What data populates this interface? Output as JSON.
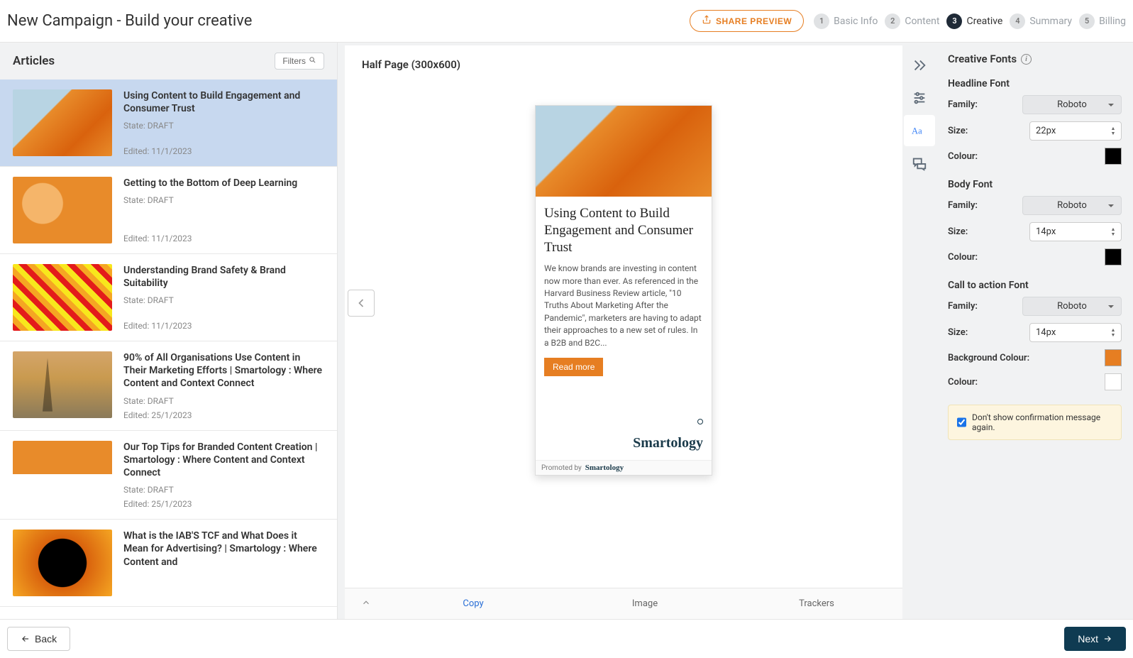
{
  "header": {
    "title": "New Campaign - Build your creative",
    "share_preview": "SHARE PREVIEW",
    "steps": [
      {
        "num": "1",
        "label": "Basic Info",
        "active": false
      },
      {
        "num": "2",
        "label": "Content",
        "active": false
      },
      {
        "num": "3",
        "label": "Creative",
        "active": true
      },
      {
        "num": "4",
        "label": "Summary",
        "active": false
      },
      {
        "num": "5",
        "label": "Billing",
        "active": false
      }
    ]
  },
  "articles_panel": {
    "title": "Articles",
    "filters_label": "Filters"
  },
  "articles": [
    {
      "title": "Using Content to Build Engagement and Consumer Trust",
      "state": "State: DRAFT",
      "edited": "Edited: 11/1/2023",
      "selected": true,
      "thumb": "thumb1"
    },
    {
      "title": "Getting to the Bottom of Deep Learning",
      "state": "State: DRAFT",
      "edited": "Edited: 11/1/2023",
      "selected": false,
      "thumb": "thumb2"
    },
    {
      "title": "Understanding Brand Safety & Brand Suitability",
      "state": "State: DRAFT",
      "edited": "Edited: 11/1/2023",
      "selected": false,
      "thumb": "thumb3"
    },
    {
      "title": "90% of All Organisations Use Content in Their Marketing Efforts | Smartology : Where Content and Context Connect",
      "state": "State: DRAFT",
      "edited": "Edited: 25/1/2023",
      "selected": false,
      "thumb": "thumb4"
    },
    {
      "title": "Our Top Tips for Branded Content Creation | Smartology : Where Content and Context Connect",
      "state": "State: DRAFT",
      "edited": "Edited: 25/1/2023",
      "selected": false,
      "thumb": "thumb5"
    },
    {
      "title": "What is the IAB'S TCF and What Does it Mean for Advertising? | Smartology : Where Content and",
      "state": "",
      "edited": "",
      "selected": false,
      "thumb": "thumb6"
    }
  ],
  "preview": {
    "size_label": "Half Page (300x600)",
    "headline": "Using Content to Build Engagement and Consumer Trust",
    "body": "We know brands are investing in content now more than ever. As referenced in the Harvard Business Review article, \"10 Truths About Marketing After the Pandemic\", marketers are having to adapt their approaches to a new set of rules. In a B2B and B2C...",
    "cta": "Read more",
    "logo": "Smartology",
    "promoted_prefix": "Promoted by",
    "promoted_brand": "Smartology"
  },
  "tabs": {
    "copy": "Copy",
    "image": "Image",
    "trackers": "Trackers"
  },
  "fonts_panel": {
    "title": "Creative Fonts",
    "sections": {
      "headline": {
        "label": "Headline Font",
        "family_label": "Family:",
        "family": "Roboto",
        "size_label": "Size:",
        "size": "22px",
        "colour_label": "Colour:",
        "colour": "#000000"
      },
      "body": {
        "label": "Body Font",
        "family_label": "Family:",
        "family": "Roboto",
        "size_label": "Size:",
        "size": "14px",
        "colour_label": "Colour:",
        "colour": "#000000"
      },
      "cta": {
        "label": "Call to action Font",
        "family_label": "Family:",
        "family": "Roboto",
        "size_label": "Size:",
        "size": "14px",
        "bg_label": "Background Colour:",
        "bg": "#e67e22",
        "colour_label": "Colour:",
        "colour": "#ffffff"
      }
    },
    "notice": "Don't show confirmation message again."
  },
  "footer": {
    "back": "Back",
    "next": "Next"
  }
}
